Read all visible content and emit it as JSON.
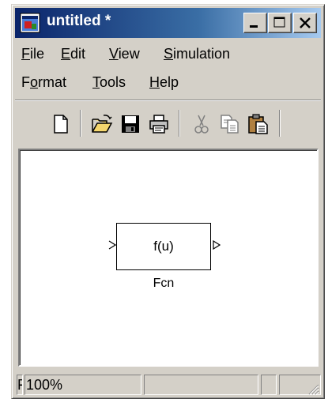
{
  "window": {
    "title": "untitled *"
  },
  "caption_buttons": {
    "minimize": "minimize",
    "maximize": "maximize",
    "close": "close"
  },
  "menu": {
    "row1": [
      {
        "pre": "",
        "acc": "F",
        "post": "ile"
      },
      {
        "pre": "",
        "acc": "E",
        "post": "dit"
      },
      {
        "pre": "",
        "acc": "V",
        "post": "iew"
      },
      {
        "pre": "",
        "acc": "S",
        "post": "imulation"
      }
    ],
    "row2": [
      {
        "pre": "F",
        "acc": "o",
        "post": "rmat"
      },
      {
        "pre": "",
        "acc": "T",
        "post": "ools"
      },
      {
        "pre": "",
        "acc": "H",
        "post": "elp"
      }
    ]
  },
  "toolbar": {
    "buttons": [
      "new-icon",
      "open-icon",
      "save-icon",
      "print-icon",
      "cut-icon",
      "copy-icon",
      "paste-icon"
    ]
  },
  "canvas": {
    "block": {
      "expression": "f(u)",
      "name": "Fcn"
    }
  },
  "status": {
    "left": "F",
    "zoom": "100%"
  },
  "colors": {
    "title_start": "#0a246a",
    "title_end": "#a6caf0",
    "face": "#d4d0c8"
  }
}
